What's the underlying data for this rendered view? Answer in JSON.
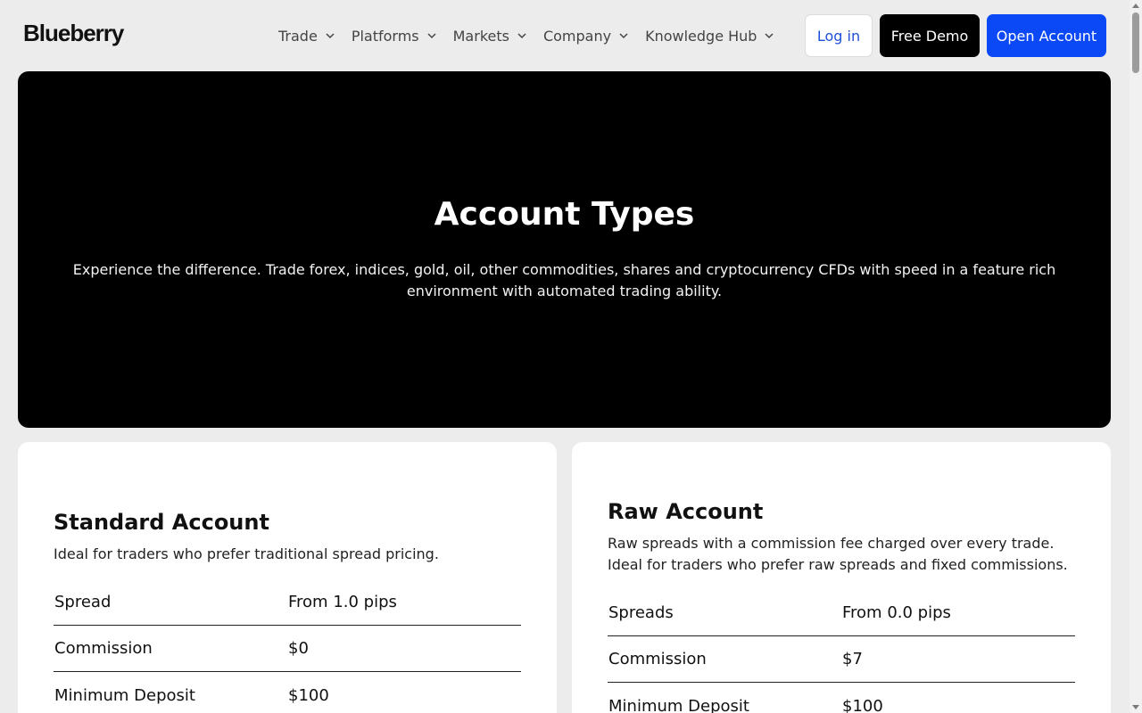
{
  "header": {
    "logo": "Blueberry",
    "nav": [
      {
        "label": "Trade"
      },
      {
        "label": "Platforms"
      },
      {
        "label": "Markets"
      },
      {
        "label": "Company"
      },
      {
        "label": "Knowledge Hub"
      }
    ],
    "login_label": "Log in",
    "demo_label": "Free Demo",
    "open_label": "Open Account"
  },
  "hero": {
    "title": "Account Types",
    "subtitle": "Experience the difference. Trade forex, indices, gold, oil, other commodities, shares and cryptocurrency CFDs with speed in a feature rich environment with automated trading ability."
  },
  "accounts": [
    {
      "title": "Standard Account",
      "description": "Ideal for traders who prefer traditional spread pricing.",
      "specs": [
        {
          "key": "Spread",
          "value": "From 1.0 pips"
        },
        {
          "key": "Commission",
          "value": "$0"
        },
        {
          "key": "Minimum Deposit",
          "value": "$100"
        }
      ]
    },
    {
      "title": "Raw Account",
      "description": "Raw spreads with a commission fee charged over every trade. Ideal for traders who prefer raw spreads and fixed commissions.",
      "specs": [
        {
          "key": "Spreads",
          "value": "From 0.0 pips"
        },
        {
          "key": "Commission",
          "value": "$7"
        },
        {
          "key": "Minimum Deposit",
          "value": "$100"
        }
      ]
    }
  ],
  "colors": {
    "primary": "#0a49f5",
    "login_text": "#1e4fd8",
    "hero_bg": "#000000",
    "page_bg": "#ececec"
  }
}
